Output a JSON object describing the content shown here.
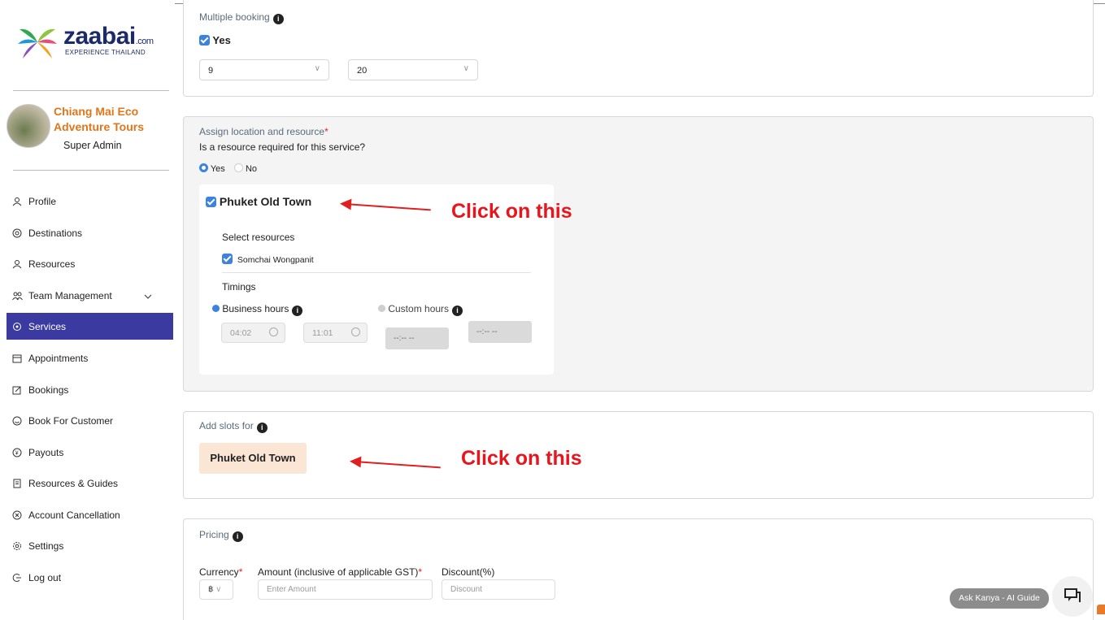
{
  "brand": {
    "logo_word": "zaabai",
    "logo_suffix": ".com",
    "logo_tagline": "EXPERIENCE THAILAND"
  },
  "profile": {
    "business_name": "Chiang Mai Eco Adventure Tours",
    "role": "Super Admin"
  },
  "nav": {
    "items": [
      {
        "label": "Profile",
        "icon": "user-icon"
      },
      {
        "label": "Destinations",
        "icon": "location-icon"
      },
      {
        "label": "Resources",
        "icon": "user-icon"
      },
      {
        "label": "Team Management",
        "icon": "team-icon"
      },
      {
        "label": "Services",
        "icon": "services-icon",
        "active": true
      },
      {
        "label": "Appointments",
        "icon": "calendar-icon"
      },
      {
        "label": "Bookings",
        "icon": "edit-icon"
      },
      {
        "label": "Book For Customer",
        "icon": "smile-icon"
      },
      {
        "label": "Payouts",
        "icon": "coin-icon"
      },
      {
        "label": "Resources & Guides",
        "icon": "document-icon"
      },
      {
        "label": "Account Cancellation",
        "icon": "close-circle-icon"
      },
      {
        "label": "Settings",
        "icon": "gear-icon"
      },
      {
        "label": "Log out",
        "icon": "logout-icon"
      }
    ]
  },
  "multiple_booking": {
    "label": "Multiple booking",
    "checkbox_label": "Yes",
    "select_1": "9",
    "select_2": "20"
  },
  "assign": {
    "label": "Assign location and resource",
    "required_mark": "*",
    "question": "Is a resource required for this service?",
    "option_yes": "Yes",
    "option_no": "No",
    "location": "Phuket Old Town",
    "select_resources_label": "Select resources",
    "resource": "Somchai Wongpanit",
    "timings_label": "Timings",
    "business_hours_label": "Business hours",
    "custom_hours_label": "Custom hours",
    "bh_start": "04:02",
    "bh_end": "11:01",
    "ch_start": "--:-- --",
    "ch_end": "--:-- --"
  },
  "slots": {
    "label": "Add slots for",
    "location_button": "Phuket Old Town"
  },
  "pricing": {
    "label": "Pricing",
    "currency_label": "Currency",
    "amount_label": "Amount (inclusive of applicable GST)",
    "discount_label": "Discount(%)",
    "currency_value": "฿",
    "amount_placeholder": "Enter Amount",
    "discount_placeholder": "Discount"
  },
  "annotations": {
    "callout_1": "Click on this",
    "callout_2": "Click on this",
    "color": "#e8161c"
  },
  "assistant": {
    "label": "Ask Kanya - AI Guide"
  },
  "colors": {
    "nav_active": "#3a3aa0",
    "brand_orange": "#e0761b",
    "checkbox_blue": "#3c82e0",
    "slot_button_bg": "#fbe6d6"
  }
}
